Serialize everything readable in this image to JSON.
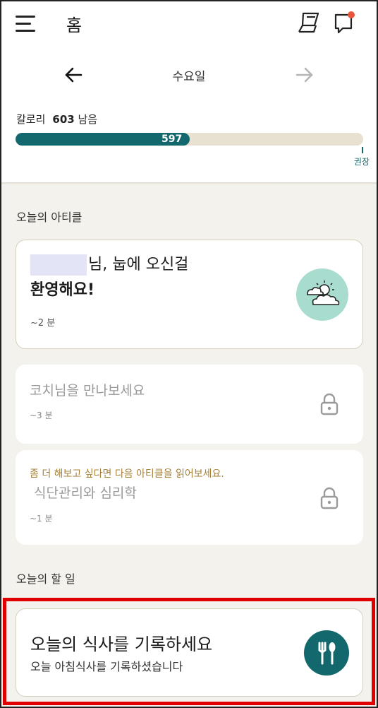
{
  "header": {
    "title": "홈",
    "day": "수요일"
  },
  "calories": {
    "label": "칼로리",
    "remaining_value": "603",
    "remaining_unit": "남음",
    "consumed": "597",
    "progress_fraction": 0.5,
    "recommended_label": "권장"
  },
  "articles": {
    "section_title": "오늘의 아티클",
    "items": [
      {
        "title_line1": "님, 눕에 오신걸",
        "title_line2": "환영해요!",
        "duration": "~2 분"
      },
      {
        "title": "코치님을 만나보세요",
        "duration": "~3 분"
      },
      {
        "promo": "좀 더 해보고 싶다면 다음 아티클을 읽어보세요.",
        "title": "식단관리와 심리학",
        "duration": "~1 분"
      }
    ]
  },
  "todo": {
    "section_title": "오늘의 할 일",
    "title": "오늘의 식사를 기록하세요",
    "subtitle": "오늘 아침식사를 기록하셨습니다"
  },
  "colors": {
    "accent": "#13686e",
    "background": "#f4f2ec",
    "highlight": "#e10000",
    "notification_dot": "#e8573a"
  }
}
